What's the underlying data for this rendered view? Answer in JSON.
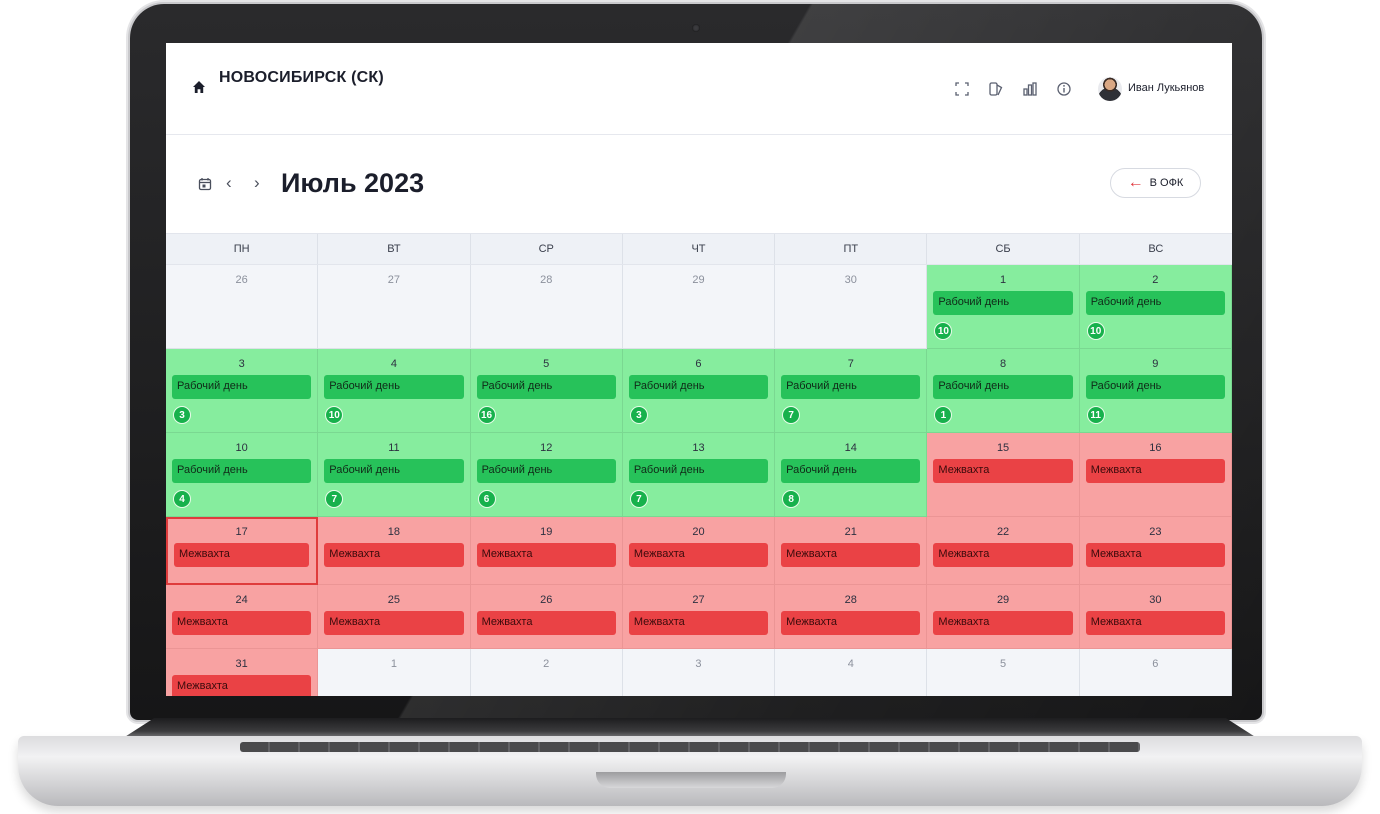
{
  "topbar": {
    "city": "НОВОСИБИРСК (СК)",
    "user_name": "Иван Лукьянов",
    "icons": [
      "fullscreen-icon",
      "layers-icon",
      "chart-icon",
      "info-icon"
    ]
  },
  "calendar": {
    "month_title": "Июль 2023",
    "back_label": "В ОФК",
    "weekdays": [
      "ПН",
      "ВТ",
      "СР",
      "ЧТ",
      "ПТ",
      "СБ",
      "ВС"
    ],
    "colors": {
      "work": "#86ed9e",
      "work_event": "#27c25a",
      "off": "#f8a2a2",
      "off_event": "#ea4245"
    },
    "days": [
      {
        "day": "26",
        "type": "out",
        "label": "",
        "count": ""
      },
      {
        "day": "27",
        "type": "out",
        "label": "",
        "count": ""
      },
      {
        "day": "28",
        "type": "out",
        "label": "",
        "count": ""
      },
      {
        "day": "29",
        "type": "out",
        "label": "",
        "count": ""
      },
      {
        "day": "30",
        "type": "out",
        "label": "",
        "count": ""
      },
      {
        "day": "1",
        "type": "work",
        "label": "Рабочий день",
        "count": "10"
      },
      {
        "day": "2",
        "type": "work",
        "label": "Рабочий день",
        "count": "10"
      },
      {
        "day": "3",
        "type": "work",
        "label": "Рабочий день",
        "count": "3"
      },
      {
        "day": "4",
        "type": "work",
        "label": "Рабочий день",
        "count": "10"
      },
      {
        "day": "5",
        "type": "work",
        "label": "Рабочий день",
        "count": "16"
      },
      {
        "day": "6",
        "type": "work",
        "label": "Рабочий день",
        "count": "3"
      },
      {
        "day": "7",
        "type": "work",
        "label": "Рабочий день",
        "count": "7"
      },
      {
        "day": "8",
        "type": "work",
        "label": "Рабочий день",
        "count": "1"
      },
      {
        "day": "9",
        "type": "work",
        "label": "Рабочий день",
        "count": "11"
      },
      {
        "day": "10",
        "type": "work",
        "label": "Рабочий день",
        "count": "4"
      },
      {
        "day": "11",
        "type": "work",
        "label": "Рабочий день",
        "count": "7"
      },
      {
        "day": "12",
        "type": "work",
        "label": "Рабочий день",
        "count": "6"
      },
      {
        "day": "13",
        "type": "work",
        "label": "Рабочий день",
        "count": "7"
      },
      {
        "day": "14",
        "type": "work",
        "label": "Рабочий день",
        "count": "8"
      },
      {
        "day": "15",
        "type": "off",
        "label": "Межвахта",
        "count": ""
      },
      {
        "day": "16",
        "type": "off",
        "label": "Межвахта",
        "count": ""
      },
      {
        "day": "17",
        "type": "off",
        "label": "Межвахта",
        "count": "",
        "today": true
      },
      {
        "day": "18",
        "type": "off",
        "label": "Межвахта",
        "count": ""
      },
      {
        "day": "19",
        "type": "off",
        "label": "Межвахта",
        "count": ""
      },
      {
        "day": "20",
        "type": "off",
        "label": "Межвахта",
        "count": ""
      },
      {
        "day": "21",
        "type": "off",
        "label": "Межвахта",
        "count": ""
      },
      {
        "day": "22",
        "type": "off",
        "label": "Межвахта",
        "count": ""
      },
      {
        "day": "23",
        "type": "off",
        "label": "Межвахта",
        "count": ""
      },
      {
        "day": "24",
        "type": "off",
        "label": "Межвахта",
        "count": ""
      },
      {
        "day": "25",
        "type": "off",
        "label": "Межвахта",
        "count": ""
      },
      {
        "day": "26",
        "type": "off",
        "label": "Межвахта",
        "count": ""
      },
      {
        "day": "27",
        "type": "off",
        "label": "Межвахта",
        "count": ""
      },
      {
        "day": "28",
        "type": "off",
        "label": "Межвахта",
        "count": ""
      },
      {
        "day": "29",
        "type": "off",
        "label": "Межвахта",
        "count": ""
      },
      {
        "day": "30",
        "type": "off",
        "label": "Межвахта",
        "count": ""
      },
      {
        "day": "31",
        "type": "off",
        "label": "Межвахта",
        "count": ""
      },
      {
        "day": "1",
        "type": "out",
        "label": "",
        "count": ""
      },
      {
        "day": "2",
        "type": "out",
        "label": "",
        "count": ""
      },
      {
        "day": "3",
        "type": "out",
        "label": "",
        "count": ""
      },
      {
        "day": "4",
        "type": "out",
        "label": "",
        "count": ""
      },
      {
        "day": "5",
        "type": "out",
        "label": "",
        "count": ""
      },
      {
        "day": "6",
        "type": "out",
        "label": "",
        "count": ""
      }
    ]
  }
}
